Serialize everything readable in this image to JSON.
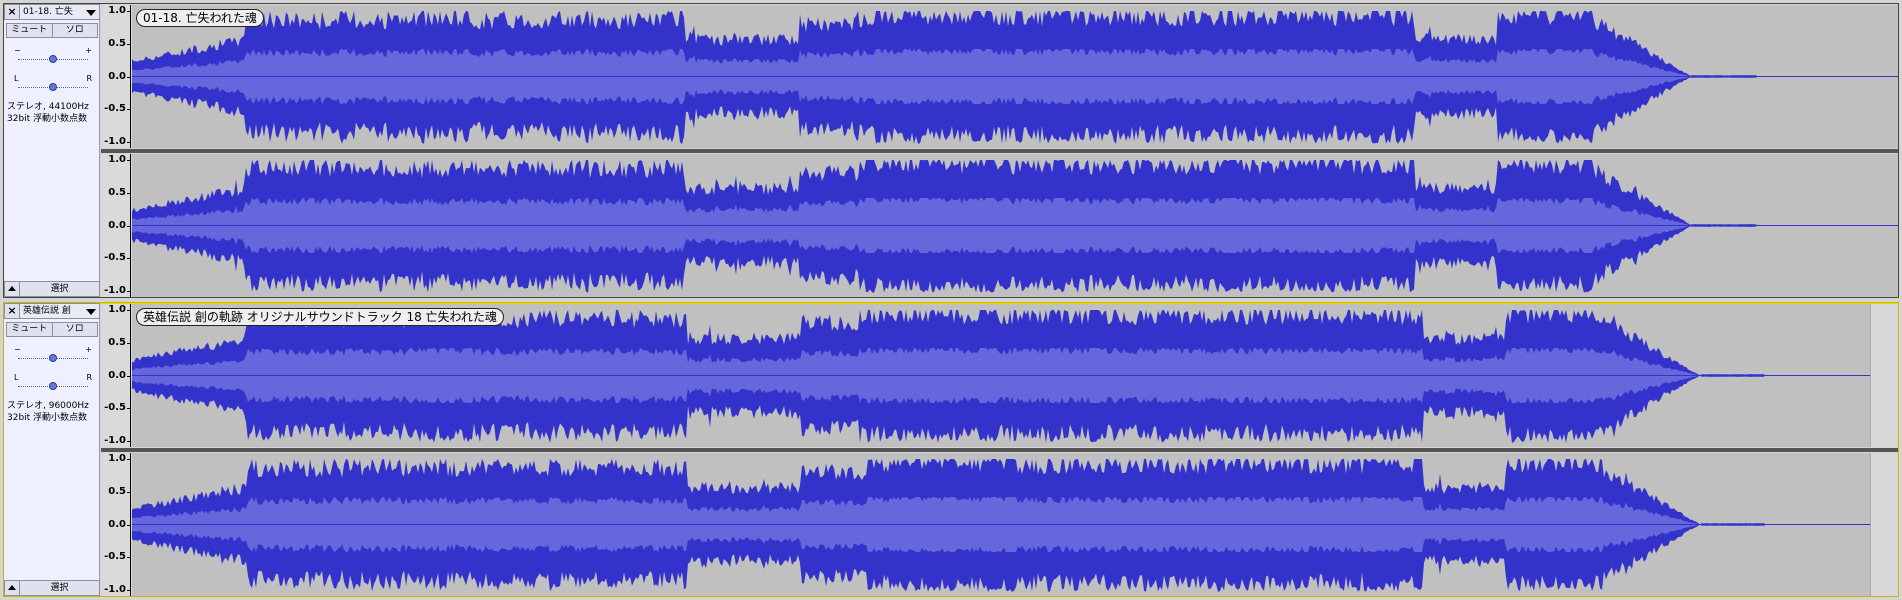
{
  "colors": {
    "wave_outer": "#3333cc",
    "wave_inner": "#6666dd",
    "clip_background": "#c0c0c0",
    "control_panel": "#eef0ff",
    "selected_border": "#e6d800"
  },
  "tracks": [
    {
      "name": "01-18. 亡失",
      "clip_label": "01-18. 亡失われた魂",
      "mute_label": "ミュート",
      "solo_label": "ソロ",
      "gain_minus": "−",
      "gain_plus": "+",
      "pan_left": "L",
      "pan_right": "R",
      "info_line1": "ステレオ, 44100Hz",
      "info_line2": "32bit 浮動小数点数",
      "select_label": "選択",
      "ticks": [
        "1.0",
        "0.5",
        "0.0",
        "-0.5",
        "-1.0"
      ],
      "close_icon": "×",
      "selected": false
    },
    {
      "name": "英雄伝説 創",
      "clip_label": "英雄伝説 創の軌跡 オリジナルサウンドトラック 18 亡失われた魂",
      "mute_label": "ミュート",
      "solo_label": "ソロ",
      "gain_minus": "−",
      "gain_plus": "+",
      "pan_left": "L",
      "pan_right": "R",
      "info_line1": "ステレオ, 96000Hz",
      "info_line2": "32bit 浮動小数点数",
      "select_label": "選択",
      "ticks": [
        "1.0",
        "0.5",
        "0.0",
        "-0.5",
        "-1.0"
      ],
      "close_icon": "×",
      "selected": true
    }
  ]
}
